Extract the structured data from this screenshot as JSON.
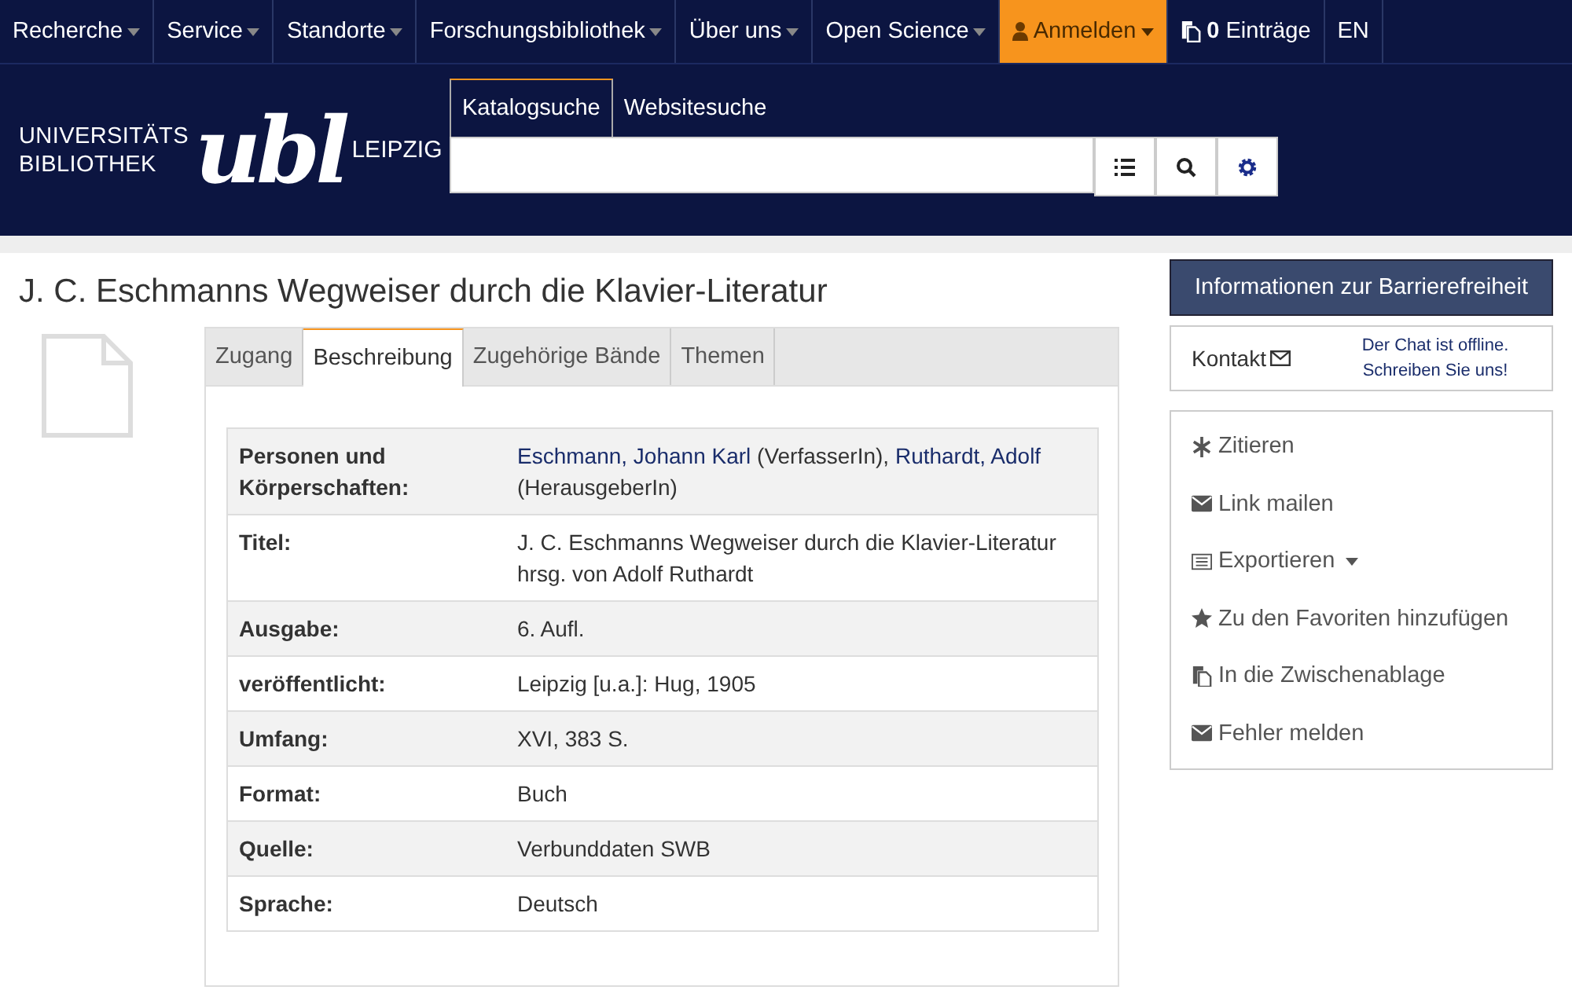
{
  "nav": [
    {
      "label": "Recherche",
      "caret": true,
      "selected": false,
      "kind": "menu"
    },
    {
      "label": "Service",
      "caret": true,
      "selected": false,
      "kind": "menu"
    },
    {
      "label": "Standorte",
      "caret": true,
      "selected": false,
      "kind": "menu"
    },
    {
      "label": "Forschungsbibliothek",
      "caret": true,
      "selected": false,
      "kind": "menu"
    },
    {
      "label": "Über uns",
      "caret": true,
      "selected": false,
      "kind": "menu"
    },
    {
      "label": "Open Science",
      "caret": true,
      "selected": false,
      "kind": "menu"
    },
    {
      "label": "Anmelden",
      "caret": true,
      "selected": true,
      "kind": "login"
    },
    {
      "label": "**0** Einträge",
      "caret": false,
      "selected": false,
      "kind": "cart"
    },
    {
      "label": "EN",
      "caret": false,
      "selected": false,
      "kind": "plain"
    }
  ],
  "logo": {
    "line_1": "UNIVERSITÄTS",
    "line_2": "BIBLIOTHEK",
    "mark": "ubl",
    "city": "LEIPZIG"
  },
  "search_tabs": [
    {
      "label": "Katalogsuche",
      "selected": true
    },
    {
      "label": "Websitesuche",
      "selected": false
    }
  ],
  "title": "J. C. Eschmanns Wegweiser durch die Klavier-Literatur",
  "tabs": [
    {
      "label": "Zugang",
      "selected": false
    },
    {
      "label": "Beschreibung",
      "selected": true
    },
    {
      "label": "Zugehörige Bände",
      "selected": false
    },
    {
      "label": "Themen",
      "selected": false
    }
  ],
  "details": [
    {
      "label": "Personen und Körperschaften:",
      "value": [
        {
          "text": "Eschmann, Johann Karl",
          "link": true
        },
        {
          "text": " (VerfasserIn), ",
          "link": false
        },
        {
          "text": "Ruthardt, Adolf",
          "link": true
        },
        {
          "text": " (HerausgeberIn)",
          "link": false
        }
      ]
    },
    {
      "label": "Titel:",
      "value": [
        {
          "text": "J. C. Eschmanns Wegweiser durch die Klavier-Literatur hrsg. von Adolf Ruthardt",
          "link": false
        }
      ]
    },
    {
      "label": "Ausgabe:",
      "value": [
        {
          "text": "6. Aufl.",
          "link": false
        }
      ]
    },
    {
      "label": "veröffentlicht:",
      "value": [
        {
          "text": "Leipzig [u.a.]: Hug, 1905",
          "link": false
        }
      ]
    },
    {
      "label": "Umfang:",
      "value": [
        {
          "text": "XVI, 383 S.",
          "link": false
        }
      ]
    },
    {
      "label": "Format:",
      "value": [
        {
          "text": "Buch",
          "link": false
        }
      ]
    },
    {
      "label": "Quelle:",
      "value": [
        {
          "text": "Verbunddaten SWB",
          "link": false
        }
      ]
    },
    {
      "label": "Sprache:",
      "value": [
        {
          "text": "Deutsch",
          "link": false
        }
      ]
    }
  ],
  "accessibility_button": "Informationen zur Barrierefreiheit",
  "contact": {
    "label": "Kontakt",
    "chat_status": "Der Chat ist offline. Schreiben Sie uns!"
  },
  "actions": [
    {
      "label": "Zitieren",
      "kind": "asterisk",
      "caret": false
    },
    {
      "label": "Link mailen",
      "kind": "mail",
      "caret": false
    },
    {
      "label": "Exportieren",
      "kind": "list",
      "caret": true
    },
    {
      "label": "Zu den Favoriten hinzufügen",
      "kind": "star",
      "caret": false
    },
    {
      "label": "In die Zwischenablage",
      "kind": "copy",
      "caret": false
    },
    {
      "label": "Fehler melden",
      "kind": "mail",
      "caret": false
    }
  ]
}
